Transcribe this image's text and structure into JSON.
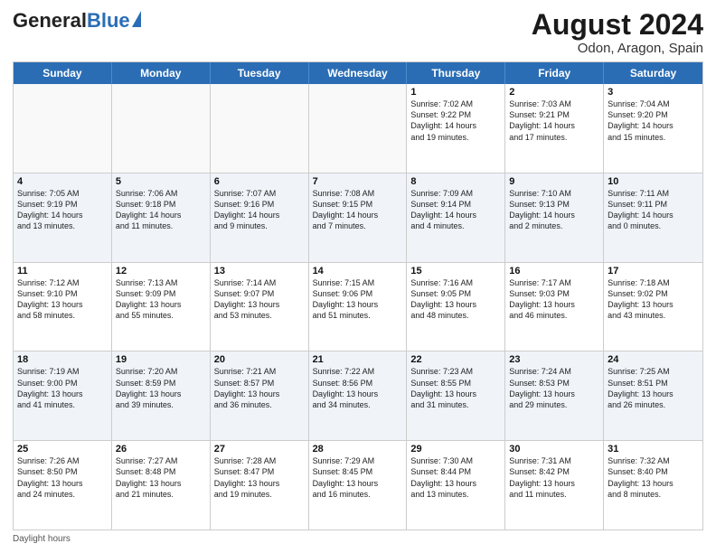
{
  "header": {
    "logo_general": "General",
    "logo_blue": "Blue",
    "month_year": "August 2024",
    "location": "Odon, Aragon, Spain"
  },
  "calendar": {
    "days_of_week": [
      "Sunday",
      "Monday",
      "Tuesday",
      "Wednesday",
      "Thursday",
      "Friday",
      "Saturday"
    ],
    "weeks": [
      [
        {
          "day": "",
          "text": ""
        },
        {
          "day": "",
          "text": ""
        },
        {
          "day": "",
          "text": ""
        },
        {
          "day": "",
          "text": ""
        },
        {
          "day": "1",
          "text": "Sunrise: 7:02 AM\nSunset: 9:22 PM\nDaylight: 14 hours\nand 19 minutes."
        },
        {
          "day": "2",
          "text": "Sunrise: 7:03 AM\nSunset: 9:21 PM\nDaylight: 14 hours\nand 17 minutes."
        },
        {
          "day": "3",
          "text": "Sunrise: 7:04 AM\nSunset: 9:20 PM\nDaylight: 14 hours\nand 15 minutes."
        }
      ],
      [
        {
          "day": "4",
          "text": "Sunrise: 7:05 AM\nSunset: 9:19 PM\nDaylight: 14 hours\nand 13 minutes."
        },
        {
          "day": "5",
          "text": "Sunrise: 7:06 AM\nSunset: 9:18 PM\nDaylight: 14 hours\nand 11 minutes."
        },
        {
          "day": "6",
          "text": "Sunrise: 7:07 AM\nSunset: 9:16 PM\nDaylight: 14 hours\nand 9 minutes."
        },
        {
          "day": "7",
          "text": "Sunrise: 7:08 AM\nSunset: 9:15 PM\nDaylight: 14 hours\nand 7 minutes."
        },
        {
          "day": "8",
          "text": "Sunrise: 7:09 AM\nSunset: 9:14 PM\nDaylight: 14 hours\nand 4 minutes."
        },
        {
          "day": "9",
          "text": "Sunrise: 7:10 AM\nSunset: 9:13 PM\nDaylight: 14 hours\nand 2 minutes."
        },
        {
          "day": "10",
          "text": "Sunrise: 7:11 AM\nSunset: 9:11 PM\nDaylight: 14 hours\nand 0 minutes."
        }
      ],
      [
        {
          "day": "11",
          "text": "Sunrise: 7:12 AM\nSunset: 9:10 PM\nDaylight: 13 hours\nand 58 minutes."
        },
        {
          "day": "12",
          "text": "Sunrise: 7:13 AM\nSunset: 9:09 PM\nDaylight: 13 hours\nand 55 minutes."
        },
        {
          "day": "13",
          "text": "Sunrise: 7:14 AM\nSunset: 9:07 PM\nDaylight: 13 hours\nand 53 minutes."
        },
        {
          "day": "14",
          "text": "Sunrise: 7:15 AM\nSunset: 9:06 PM\nDaylight: 13 hours\nand 51 minutes."
        },
        {
          "day": "15",
          "text": "Sunrise: 7:16 AM\nSunset: 9:05 PM\nDaylight: 13 hours\nand 48 minutes."
        },
        {
          "day": "16",
          "text": "Sunrise: 7:17 AM\nSunset: 9:03 PM\nDaylight: 13 hours\nand 46 minutes."
        },
        {
          "day": "17",
          "text": "Sunrise: 7:18 AM\nSunset: 9:02 PM\nDaylight: 13 hours\nand 43 minutes."
        }
      ],
      [
        {
          "day": "18",
          "text": "Sunrise: 7:19 AM\nSunset: 9:00 PM\nDaylight: 13 hours\nand 41 minutes."
        },
        {
          "day": "19",
          "text": "Sunrise: 7:20 AM\nSunset: 8:59 PM\nDaylight: 13 hours\nand 39 minutes."
        },
        {
          "day": "20",
          "text": "Sunrise: 7:21 AM\nSunset: 8:57 PM\nDaylight: 13 hours\nand 36 minutes."
        },
        {
          "day": "21",
          "text": "Sunrise: 7:22 AM\nSunset: 8:56 PM\nDaylight: 13 hours\nand 34 minutes."
        },
        {
          "day": "22",
          "text": "Sunrise: 7:23 AM\nSunset: 8:55 PM\nDaylight: 13 hours\nand 31 minutes."
        },
        {
          "day": "23",
          "text": "Sunrise: 7:24 AM\nSunset: 8:53 PM\nDaylight: 13 hours\nand 29 minutes."
        },
        {
          "day": "24",
          "text": "Sunrise: 7:25 AM\nSunset: 8:51 PM\nDaylight: 13 hours\nand 26 minutes."
        }
      ],
      [
        {
          "day": "25",
          "text": "Sunrise: 7:26 AM\nSunset: 8:50 PM\nDaylight: 13 hours\nand 24 minutes."
        },
        {
          "day": "26",
          "text": "Sunrise: 7:27 AM\nSunset: 8:48 PM\nDaylight: 13 hours\nand 21 minutes."
        },
        {
          "day": "27",
          "text": "Sunrise: 7:28 AM\nSunset: 8:47 PM\nDaylight: 13 hours\nand 19 minutes."
        },
        {
          "day": "28",
          "text": "Sunrise: 7:29 AM\nSunset: 8:45 PM\nDaylight: 13 hours\nand 16 minutes."
        },
        {
          "day": "29",
          "text": "Sunrise: 7:30 AM\nSunset: 8:44 PM\nDaylight: 13 hours\nand 13 minutes."
        },
        {
          "day": "30",
          "text": "Sunrise: 7:31 AM\nSunset: 8:42 PM\nDaylight: 13 hours\nand 11 minutes."
        },
        {
          "day": "31",
          "text": "Sunrise: 7:32 AM\nSunset: 8:40 PM\nDaylight: 13 hours\nand 8 minutes."
        }
      ]
    ]
  },
  "footer": {
    "note": "Daylight hours"
  }
}
